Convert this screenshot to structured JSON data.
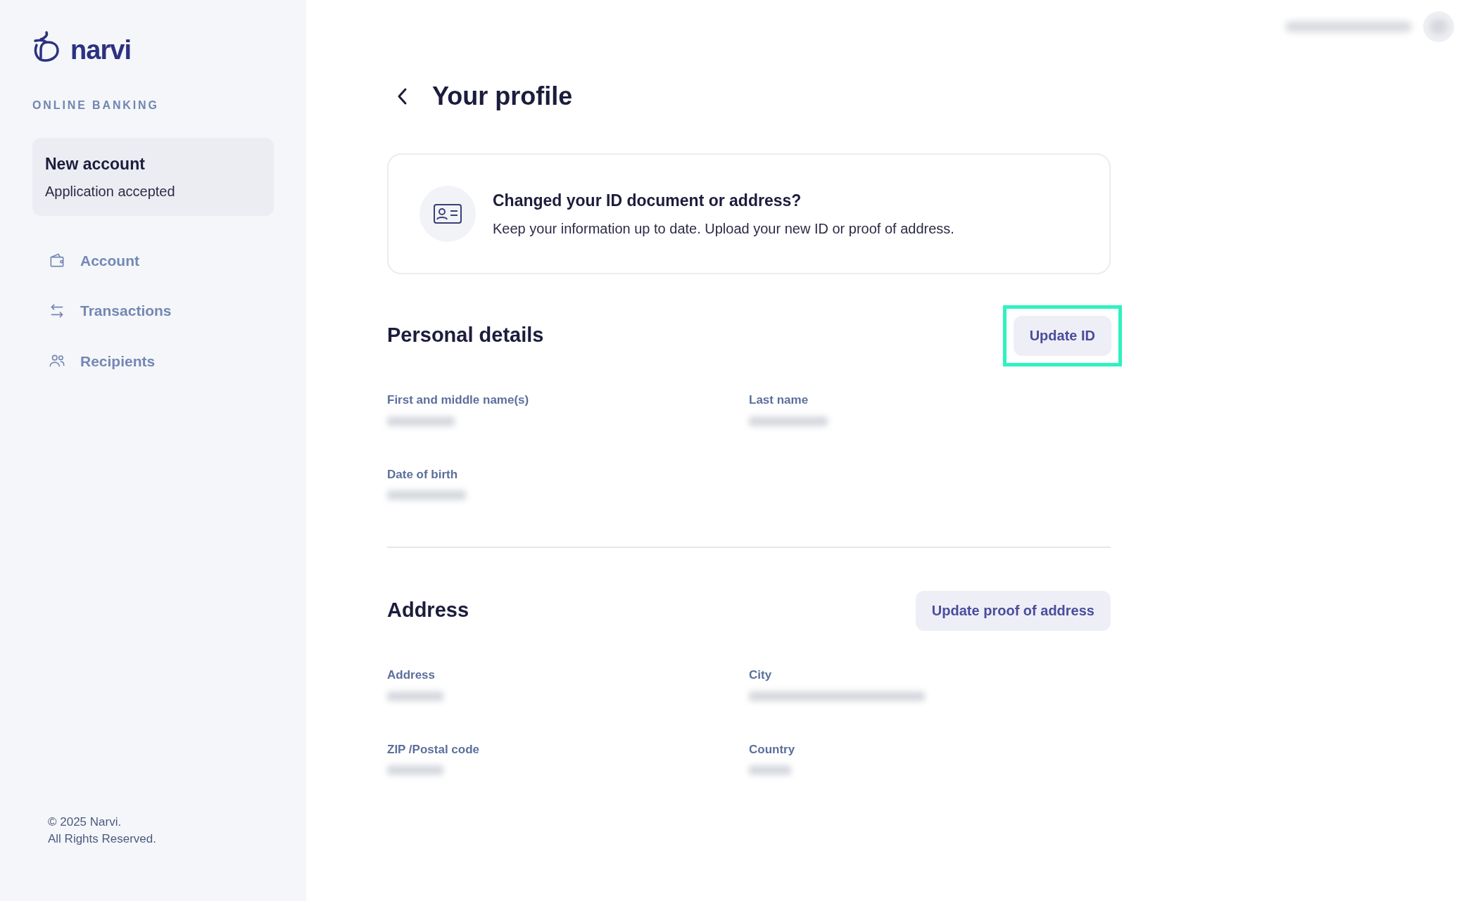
{
  "sidebar": {
    "brand": "narvi",
    "section_label": "ONLINE BANKING",
    "account_card": {
      "title": "New account",
      "status": "Application accepted"
    },
    "items": [
      {
        "label": "Account"
      },
      {
        "label": "Transactions"
      },
      {
        "label": "Recipients"
      }
    ],
    "footer": [
      "© 2025 Narvi.",
      "All Rights Reserved."
    ]
  },
  "page": {
    "title": "Your profile",
    "notice": {
      "title": "Changed your ID document or address?",
      "text": "Keep your information up to date. Upload your new ID or proof of address."
    },
    "sections": [
      {
        "title": "Personal details",
        "button": "Update ID",
        "highlighted": true,
        "fields": [
          {
            "label": "First and middle name(s)",
            "redacted": true
          },
          {
            "label": "Last name",
            "redacted": true
          },
          {
            "label": "Date of birth",
            "redacted": true
          }
        ]
      },
      {
        "title": "Address",
        "button": "Update proof of address",
        "highlighted": false,
        "fields": [
          {
            "label": "Address",
            "redacted": true
          },
          {
            "label": "City",
            "redacted": true
          },
          {
            "label": "ZIP /Postal code",
            "redacted": true
          },
          {
            "label": "Country",
            "redacted": true
          }
        ]
      }
    ]
  }
}
